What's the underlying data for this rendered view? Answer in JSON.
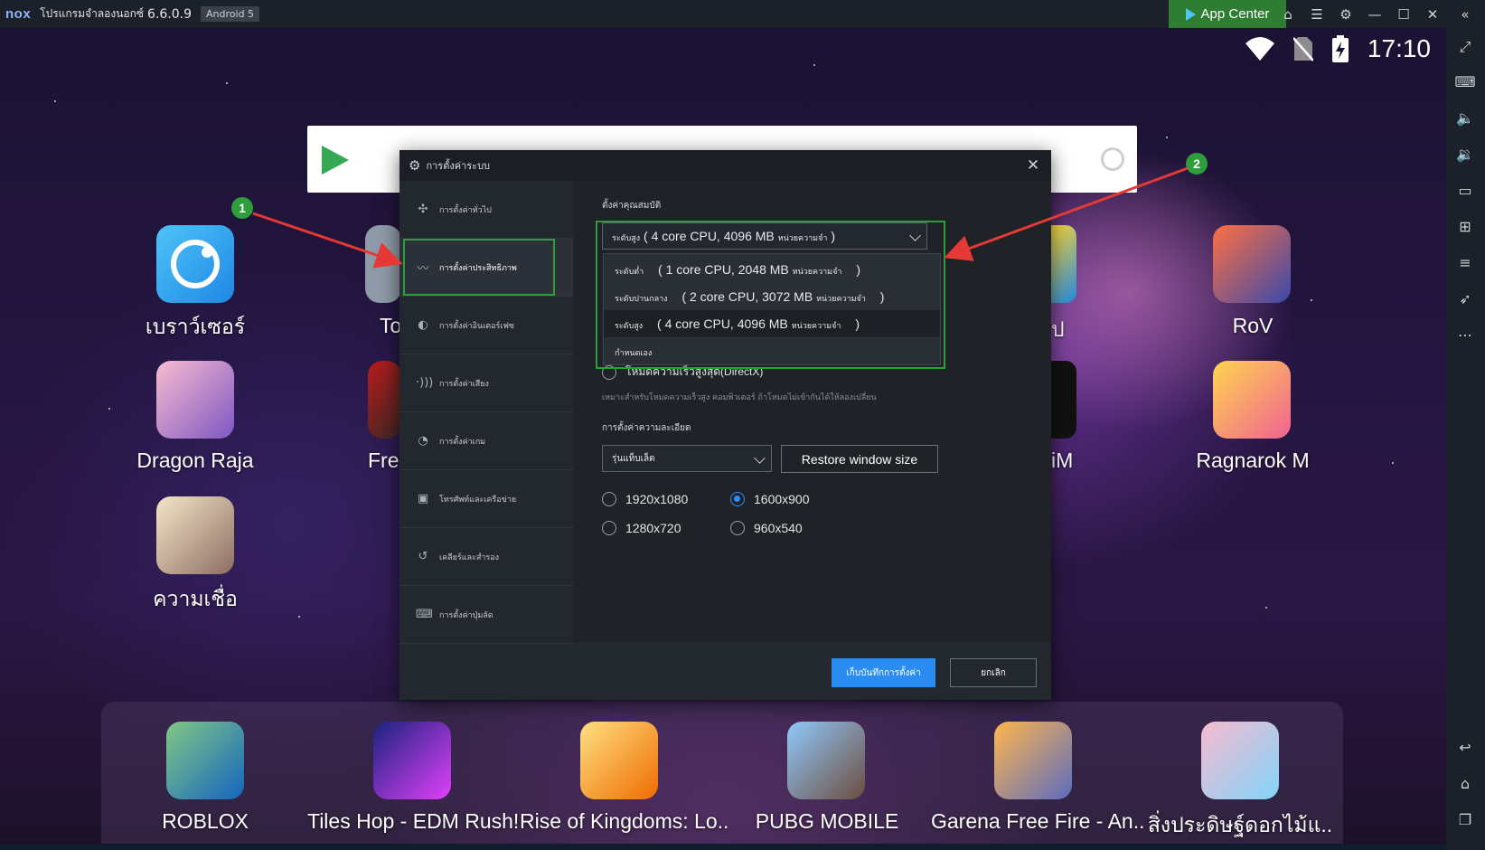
{
  "titlebar": {
    "brand": "nox",
    "app_name": "โปรแกรมจำลองนอกซ์",
    "version": "6.6.0.9",
    "android": "Android 5",
    "app_center": "App Center"
  },
  "statusbar": {
    "time": "17:10"
  },
  "desktop": {
    "icons": [
      {
        "label": "เบราว์เซอร์"
      },
      {
        "label": "Dragon Raja"
      },
      {
        "label": "ความเชื่อ"
      },
      {
        "label": "RoV"
      },
      {
        "label": "Ragnarok M"
      },
      {
        "label": "To"
      },
      {
        "label": "Free"
      },
      {
        "label": "ป"
      },
      {
        "label": "iM"
      }
    ],
    "dock": [
      {
        "label": "ROBLOX"
      },
      {
        "label": "Tiles Hop - EDM Rush!"
      },
      {
        "label": "Rise of Kingdoms: Lo.."
      },
      {
        "label": "PUBG MOBILE"
      },
      {
        "label": "Garena Free Fire - An.."
      },
      {
        "label": "สิ่งประดิษฐ์ดอกไม้แ.."
      }
    ]
  },
  "dialog": {
    "title": "การตั้งค่าระบบ",
    "nav": [
      {
        "label": "การตั้งค่าทั่วไป",
        "icon": "puzzle-icon"
      },
      {
        "label": "การตั้งค่าประสิทธิภาพ",
        "icon": "pulse-icon"
      },
      {
        "label": "การตั้งค่าอินเตอร์เฟซ",
        "icon": "palette-icon"
      },
      {
        "label": "การตั้งค่าเสียง",
        "icon": "sound-icon"
      },
      {
        "label": "การตั้งค่าเกม",
        "icon": "game-icon"
      },
      {
        "label": "โทรศัพท์และเครือข่าย",
        "icon": "phone-icon"
      },
      {
        "label": "เคลียร์และสำรอง",
        "icon": "history-icon"
      },
      {
        "label": "การตั้งค่าปุ่มลัด",
        "icon": "keyboard-icon"
      }
    ],
    "performance": {
      "section_title": "ตั้งค่าคุณสมบัติ",
      "selected_prefix": "ระดับสูง",
      "selected_main": "( 4 core CPU, 4096 MB",
      "selected_unit": "หน่วยความจำ",
      "selected_suffix": ")",
      "options": [
        {
          "prefix": "ระดับต่ำ",
          "main": "( 1 core CPU, 2048 MB",
          "unit": "หน่วยความจำ",
          "suffix": ")"
        },
        {
          "prefix": "ระดับปานกลาง",
          "main": "( 2 core CPU, 3072 MB",
          "unit": "หน่วยความจำ",
          "suffix": ")"
        },
        {
          "prefix": "ระดับสูง",
          "main": "( 4 core CPU, 4096 MB",
          "unit": "หน่วยความจำ",
          "suffix": ")"
        },
        {
          "prefix": "กำหนดเอง",
          "main": "",
          "unit": "",
          "suffix": ""
        }
      ],
      "directx_label": "โหมดความเร็วสูงสุด(DirectX)",
      "directx_note": "เหมาะสำหรับโหมดความเร็วสูง คอมพิวเตอร์ ถ้าโหมดไม่เข้ากันได้ให้ลองเปลี่ยน"
    },
    "resolution": {
      "section_title": "การตั้งค่าความละเอียด",
      "select_value": "รุ่นแท็บเล็ต",
      "restore_button": "Restore window size",
      "options": [
        {
          "label": "1920x1080",
          "selected": false
        },
        {
          "label": "1600x900",
          "selected": true
        },
        {
          "label": "1280x720",
          "selected": false
        },
        {
          "label": "960x540",
          "selected": false
        }
      ]
    },
    "buttons": {
      "save": "เก็บบันทึกการตั้งค่า",
      "cancel": "ยกเลิก"
    }
  },
  "annotations": {
    "badge1": "1",
    "badge2": "2",
    "color": "#2e9e3c",
    "arrow_color": "#e53935"
  }
}
